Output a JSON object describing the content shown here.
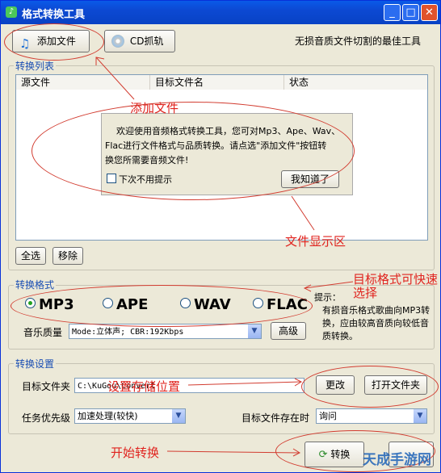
{
  "window": {
    "title": "格式转换工具"
  },
  "titlebar_buttons": [
    {
      "name": "minimize",
      "glyph": "_"
    },
    {
      "name": "maximize",
      "glyph": "□"
    },
    {
      "name": "close",
      "glyph": "✕"
    }
  ],
  "toolbar": {
    "add_file_label": "添加文件",
    "cd_rip_label": "CD抓轨",
    "tagline": "无损音质文件切割的最佳工具"
  },
  "file_list": {
    "group_label": "转换列表",
    "columns": [
      "源文件",
      "目标文件名",
      "状态"
    ],
    "select_all_label": "全选",
    "remove_label": "移除"
  },
  "welcome": {
    "line1": "欢迎使用音频格式转换工具，您可对Mp3、Ape、Wav、",
    "line2": "Flac进行文件格式与品质转换。请点选\"添加文件\"按钮转",
    "line3": "换您所需要音频文件!",
    "dont_show_label": "下次不用提示",
    "ok_label": "我知道了"
  },
  "format": {
    "group_label": "转换格式",
    "options": [
      "MP3",
      "APE",
      "WAV",
      "FLAC"
    ],
    "selected": "MP3",
    "quality_label": "音乐质量",
    "quality_value": "Mode:立体声; CBR:192Kbps",
    "advanced_label": "高级",
    "hint_title": "提示：",
    "hint_text": "有损音乐格式歌曲向MP3转换，应由较高音质向较低音质转换。"
  },
  "settings": {
    "group_label": "转换设置",
    "target_folder_label": "目标文件夹",
    "target_folder_value": "C:\\KuGou\\Convert",
    "change_label": "更改",
    "open_folder_label": "打开文件夹",
    "priority_label": "任务优先级",
    "priority_value": "加速处理(较快)",
    "exists_label": "目标文件存在时",
    "exists_value": "询问"
  },
  "start_button_label": "转换",
  "annotations": {
    "add_file": "添加文件",
    "file_area": "文件显示区",
    "target_format": "目标格式可快速选择",
    "save_location": "设置存储位置",
    "start": "开始转换"
  },
  "watermark": "天成手游网",
  "colors": {
    "accent": "#0842c4",
    "annotation": "#e0231e",
    "group_label": "#1a4eb3"
  }
}
